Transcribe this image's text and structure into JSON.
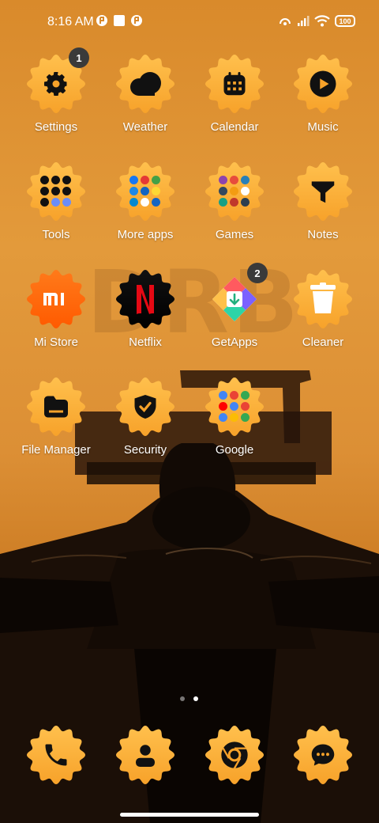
{
  "status_bar": {
    "time": "8:16 AM",
    "battery": "100"
  },
  "apps": [
    {
      "id": "settings",
      "label": "Settings",
      "badge": "1",
      "icon": "gear-icon"
    },
    {
      "id": "weather",
      "label": "Weather",
      "badge": "",
      "icon": "cloud-icon"
    },
    {
      "id": "calendar",
      "label": "Calendar",
      "badge": "",
      "icon": "calendar-icon"
    },
    {
      "id": "music",
      "label": "Music",
      "badge": "",
      "icon": "play-icon"
    },
    {
      "id": "tools",
      "label": "Tools",
      "badge": "",
      "icon": "folder-icon"
    },
    {
      "id": "more-apps",
      "label": "More apps",
      "badge": "",
      "icon": "folder-icon"
    },
    {
      "id": "games",
      "label": "Games",
      "badge": "",
      "icon": "folder-icon"
    },
    {
      "id": "notes",
      "label": "Notes",
      "badge": "",
      "icon": "notes-icon"
    },
    {
      "id": "mi-store",
      "label": "Mi Store",
      "badge": "",
      "icon": "mi-logo-icon"
    },
    {
      "id": "netflix",
      "label": "Netflix",
      "badge": "",
      "icon": "netflix-logo-icon"
    },
    {
      "id": "getapps",
      "label": "GetApps",
      "badge": "2",
      "icon": "getapps-logo-icon"
    },
    {
      "id": "cleaner",
      "label": "Cleaner",
      "badge": "",
      "icon": "trash-icon"
    },
    {
      "id": "file-manager",
      "label": "File Manager",
      "badge": "",
      "icon": "folder-file-icon"
    },
    {
      "id": "security",
      "label": "Security",
      "badge": "",
      "icon": "shield-check-icon"
    },
    {
      "id": "google",
      "label": "Google",
      "badge": "",
      "icon": "folder-icon"
    }
  ],
  "dock": [
    {
      "id": "phone",
      "icon": "phone-icon"
    },
    {
      "id": "contacts",
      "icon": "contact-icon"
    },
    {
      "id": "chrome",
      "icon": "chrome-icon"
    },
    {
      "id": "messages",
      "icon": "message-icon"
    }
  ],
  "pager": {
    "pages": 2,
    "current": 2
  },
  "watermark": "DRB",
  "colors": {
    "icon_orange": "#f7a22a",
    "icon_orange_light": "#ffc04d",
    "label": "#ffffff",
    "badge": "#3a3a3a"
  }
}
